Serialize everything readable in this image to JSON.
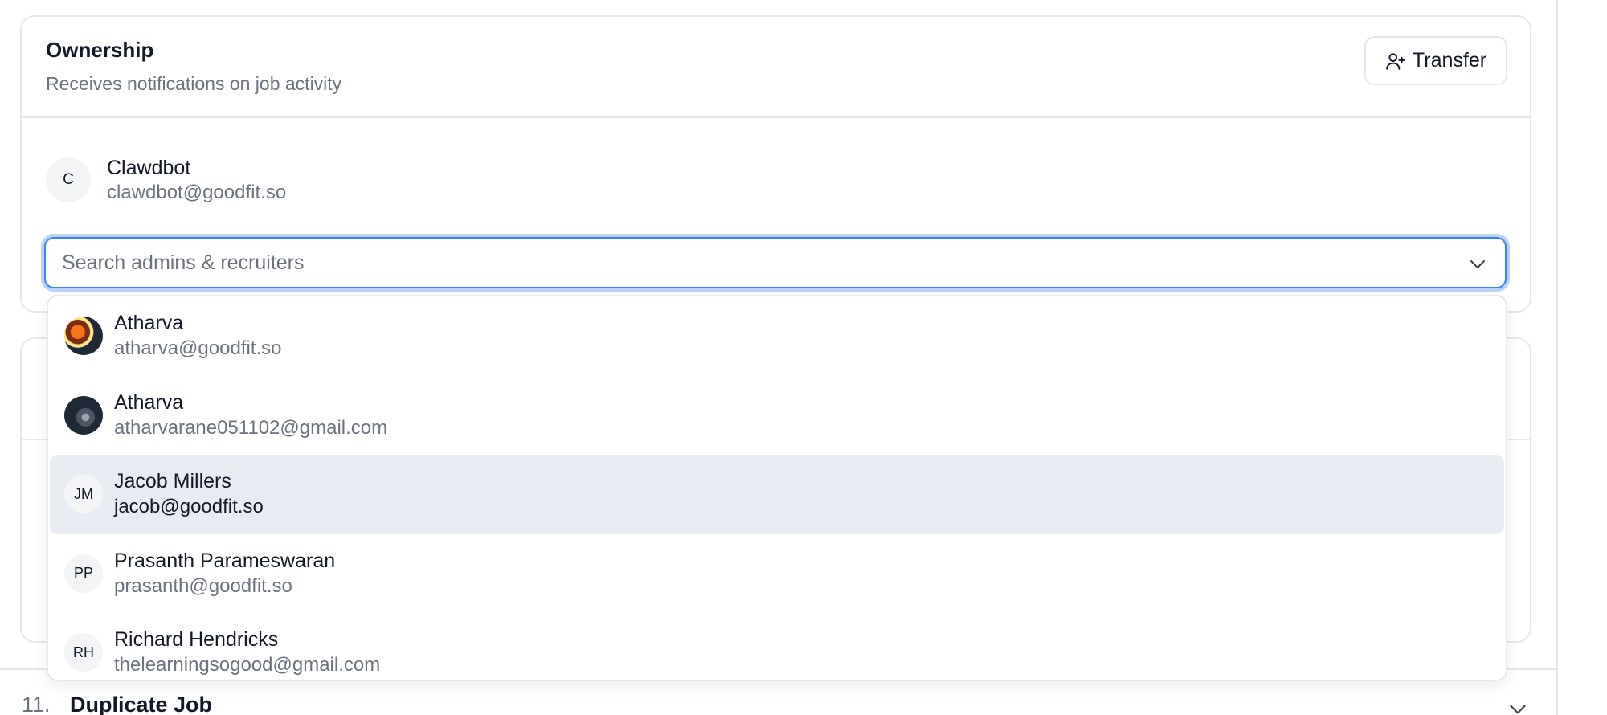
{
  "ownership": {
    "title": "Ownership",
    "subtitle": "Receives notifications on job activity",
    "transfer_label": "Transfer",
    "owner": {
      "initials": "C",
      "name": "Clawdbot",
      "email": "clawdbot@goodfit.so"
    },
    "search": {
      "placeholder": "Search admins & recruiters",
      "value": ""
    }
  },
  "dropdown": {
    "options": [
      {
        "initials": "",
        "avatar_type": "photo",
        "name": "Atharva",
        "email": "atharva@goodfit.so",
        "highlighted": false
      },
      {
        "initials": "",
        "avatar_type": "photo",
        "name": "Atharva",
        "email": "atharvarane051102@gmail.com",
        "highlighted": false
      },
      {
        "initials": "JM",
        "avatar_type": "initials",
        "name": "Jacob Millers",
        "email": "jacob@goodfit.so",
        "highlighted": true
      },
      {
        "initials": "PP",
        "avatar_type": "initials",
        "name": "Prasanth Parameswaran",
        "email": "prasanth@goodfit.so",
        "highlighted": false
      },
      {
        "initials": "RH",
        "avatar_type": "initials",
        "name": "Richard Hendricks",
        "email": "thelearningsogood@gmail.com",
        "highlighted": false
      }
    ]
  },
  "next_section": {
    "number": "11.",
    "title": "Duplicate Job"
  },
  "colors": {
    "focus_ring": "#3b82f6",
    "highlight_row": "#e8ebf1",
    "border": "#e5e7eb",
    "muted_text": "#6b7280"
  },
  "icons": {
    "transfer": "user-plus-icon",
    "dropdown": "chevron-down-icon",
    "section": "chevron-down-icon"
  }
}
